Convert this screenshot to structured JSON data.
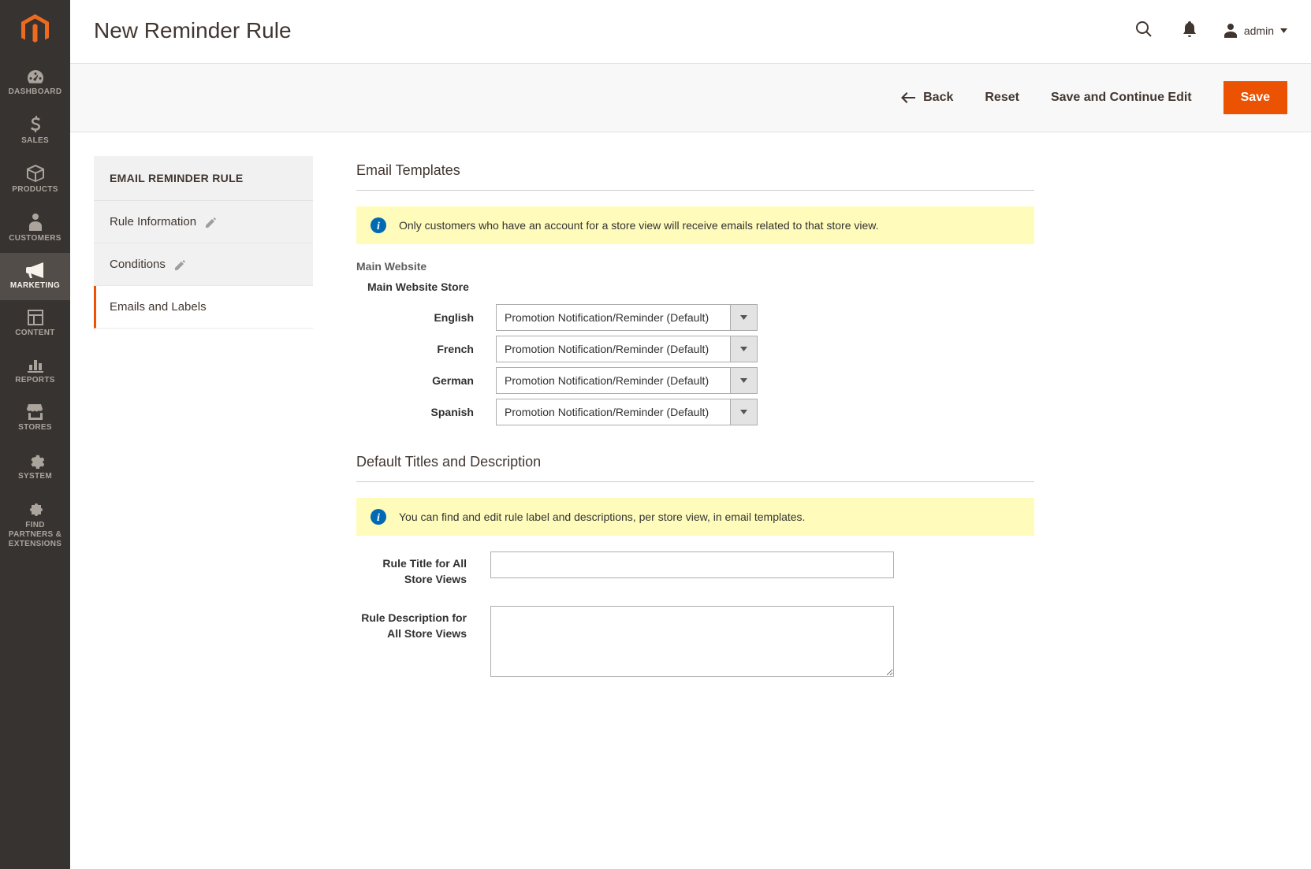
{
  "sidebar": {
    "items": [
      {
        "label": "DASHBOARD"
      },
      {
        "label": "SALES"
      },
      {
        "label": "PRODUCTS"
      },
      {
        "label": "CUSTOMERS"
      },
      {
        "label": "MARKETING"
      },
      {
        "label": "CONTENT"
      },
      {
        "label": "REPORTS"
      },
      {
        "label": "STORES"
      },
      {
        "label": "SYSTEM"
      },
      {
        "label": "FIND PARTNERS & EXTENSIONS"
      }
    ]
  },
  "header": {
    "title": "New Reminder Rule",
    "user_label": "admin"
  },
  "actions": {
    "back": "Back",
    "reset": "Reset",
    "save_continue": "Save and Continue Edit",
    "save": "Save"
  },
  "tabs": {
    "panel_title": "EMAIL REMINDER RULE",
    "items": [
      {
        "label": "Rule Information"
      },
      {
        "label": "Conditions"
      },
      {
        "label": "Emails and Labels"
      }
    ]
  },
  "form": {
    "section1_title": "Email Templates",
    "notice1": "Only customers who have an account for a store view will receive emails related to that store view.",
    "website_label": "Main Website",
    "store_label": "Main Website Store",
    "store_views": [
      {
        "label": "English",
        "value": "Promotion Notification/Reminder (Default)"
      },
      {
        "label": "French",
        "value": "Promotion Notification/Reminder (Default)"
      },
      {
        "label": "German",
        "value": "Promotion Notification/Reminder (Default)"
      },
      {
        "label": "Spanish",
        "value": "Promotion Notification/Reminder (Default)"
      }
    ],
    "section2_title": "Default Titles and Description",
    "notice2": "You can find and edit rule label and descriptions, per store view, in email templates.",
    "rule_title_label": "Rule Title for All Store Views",
    "rule_title_value": "",
    "rule_desc_label": "Rule Description for All Store Views",
    "rule_desc_value": ""
  }
}
